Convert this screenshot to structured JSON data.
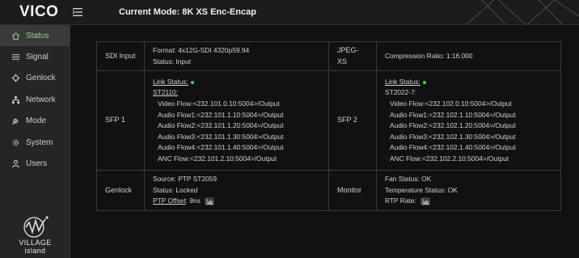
{
  "header": {
    "logo": "VICO",
    "mode_label": "Current Mode: 8K XS Enc-Encap"
  },
  "sidebar": {
    "items": [
      {
        "label": "Status",
        "icon": "home-icon",
        "active": true
      },
      {
        "label": "Signal",
        "icon": "list-icon",
        "active": false
      },
      {
        "label": "Genlock",
        "icon": "crosshair-icon",
        "active": false
      },
      {
        "label": "Network",
        "icon": "network-icon",
        "active": false
      },
      {
        "label": "Mode",
        "icon": "wrench-icon",
        "active": false
      },
      {
        "label": "System",
        "icon": "gear-icon",
        "active": false
      },
      {
        "label": "Users",
        "icon": "user-icon",
        "active": false
      }
    ],
    "brand": {
      "line1": "VILLAGE",
      "line2": "island"
    }
  },
  "status": {
    "sdi_input": {
      "label": "SDI Input",
      "format": "Format: 4x12G-SDI 4320p59.94",
      "status": "Status: Input"
    },
    "jpeg_xs": {
      "label": "JPEG-XS",
      "compression": "Compression Ratio: 1:16.000"
    },
    "sfp1": {
      "label": "SFP 1",
      "link_status": "Link Status:",
      "protocol": "ST2110:",
      "flows": [
        "Video Flow:<232.101.0.10:5004>/Output",
        "Audio Flow1:<232.101.1.10:5004>/Output",
        "Audio Flow2:<232.101.1.20:5004>/Output",
        "Audio Flow3:<232.101.1.30:5004>/Output",
        "Audio Flow4:<232.101.1.40:5004>/Output",
        "ANC Flow:<232.101.2.10:5004>/Output"
      ]
    },
    "sfp2": {
      "label": "SFP 2",
      "link_status": "Link Status:",
      "protocol": "ST2022-7:",
      "flows": [
        "Video Flow:<232.102.0.10:5004>/Output",
        "Audio Flow1:<232.102.1.10:5004>/Output",
        "Audio Flow2:<232.102.1.20:5004>/Output",
        "Audio Flow3:<232.102.1.30:5004>/Output",
        "Audio Flow4:<232.102.1.40:5004>/Output",
        "ANC Flow:<232.102.2.10:5004>/Output"
      ]
    },
    "genlock": {
      "label": "Genlock",
      "source": "Source: PTP ST2059",
      "status": "Status: Locked",
      "ptp_offset_label": "PTP Offset",
      "ptp_offset_value": ": 9ns"
    },
    "monitor": {
      "label": "Monitor",
      "fan": "Fan Status: OK",
      "temperature": "Temperature Status: OK",
      "rtp_rate": "RTP Rate:"
    }
  },
  "colors": {
    "link_ok": "#4cd14c",
    "active_nav": "#8fd38f"
  }
}
